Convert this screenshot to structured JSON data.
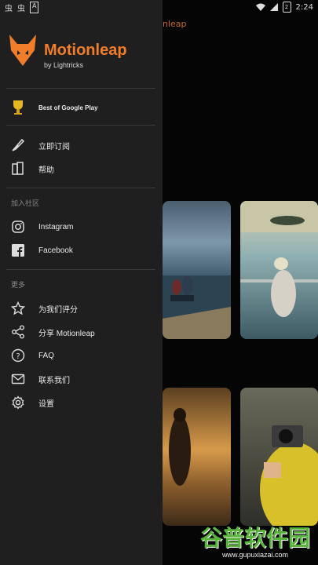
{
  "status_bar": {
    "notif_1": "虫",
    "notif_2": "虫",
    "notif_3": "A",
    "battery_level": "2",
    "time": "2:24"
  },
  "background": {
    "app_title": "nleap"
  },
  "drawer": {
    "logo": {
      "name": "Motionleap",
      "sub": "by Lightricks"
    },
    "award": "Best of Google Play",
    "items_main": [
      {
        "label": "立即订阅",
        "icon": "feather-icon"
      },
      {
        "label": "帮助",
        "icon": "book-icon"
      }
    ],
    "section_community": "加入社区",
    "items_community": [
      {
        "label": "Instagram",
        "icon": "instagram-icon"
      },
      {
        "label": "Facebook",
        "icon": "facebook-icon"
      }
    ],
    "section_more": "更多",
    "items_more": [
      {
        "label": "为我们评分",
        "icon": "star-icon"
      },
      {
        "label": "分享 Motionleap",
        "icon": "share-icon"
      },
      {
        "label": "FAQ",
        "icon": "question-icon"
      },
      {
        "label": "联系我们",
        "icon": "mail-icon"
      },
      {
        "label": "设置",
        "icon": "gear-icon"
      }
    ]
  },
  "watermark": {
    "brand": "谷普软件园",
    "url": "www.gupuxiazai.com"
  },
  "colors": {
    "accent": "#f07d2a",
    "drawer_bg": "#1f1f1f",
    "watermark_green": "#58b23b"
  }
}
